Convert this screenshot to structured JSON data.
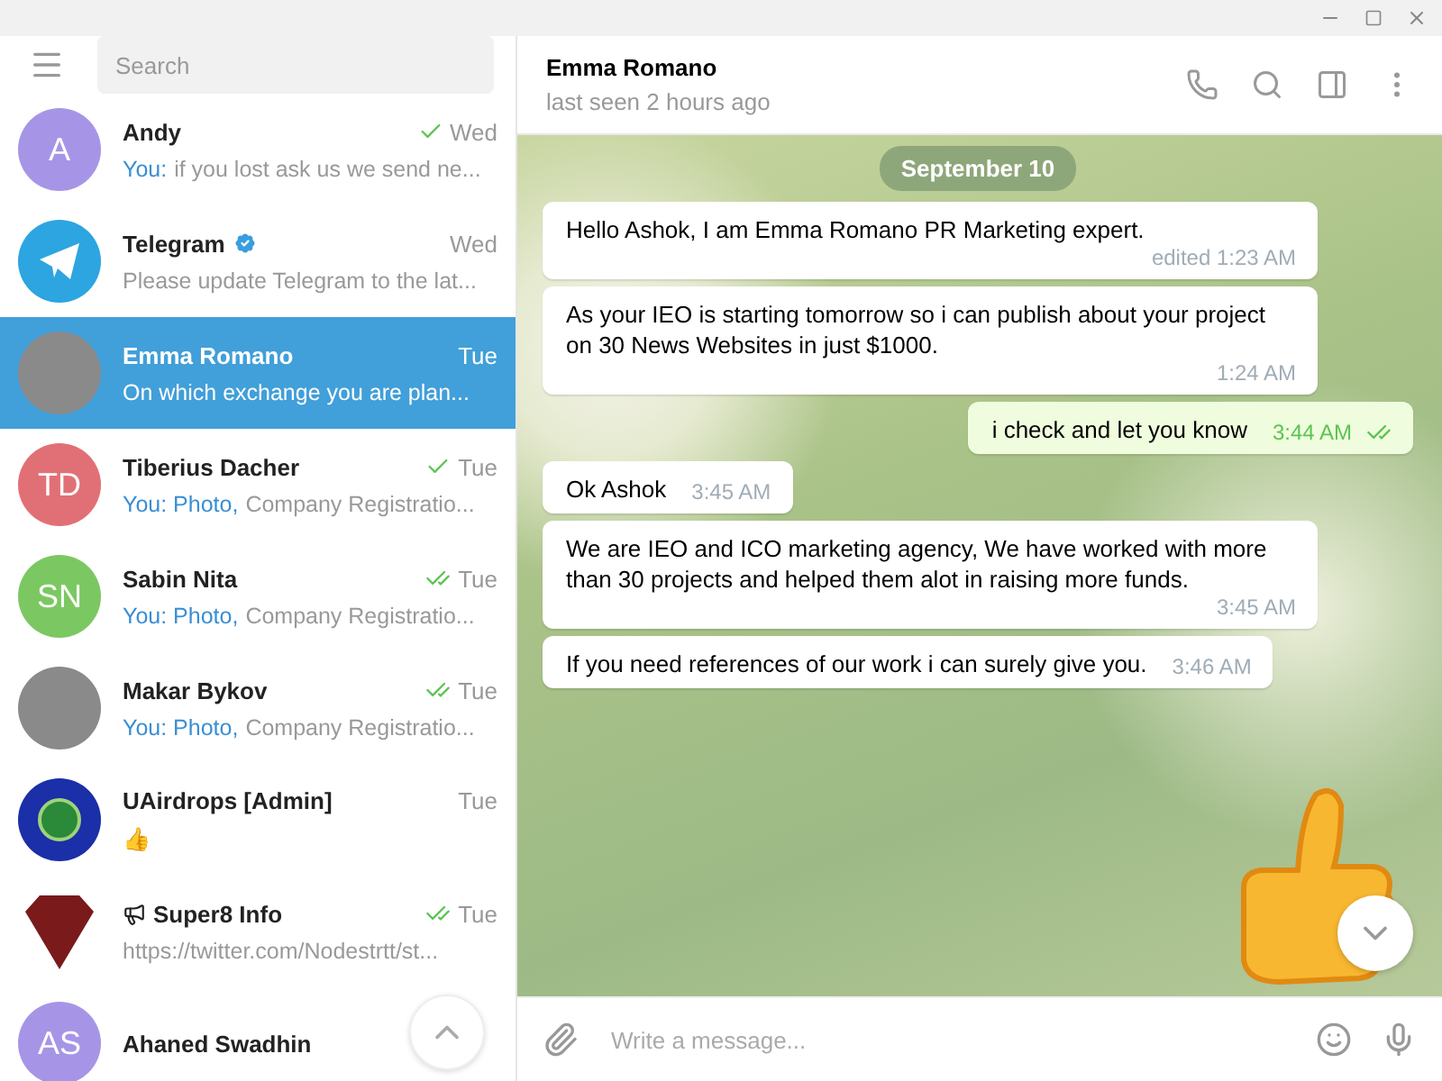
{
  "sidebar": {
    "search": {
      "placeholder": "Search"
    },
    "chats": [
      {
        "name": "Andy",
        "avatar": {
          "kind": "initials",
          "text": "A",
          "color": "#a695e7"
        },
        "time": "Wed",
        "sent": true,
        "read": false,
        "prefix": "You:",
        "preview": "if you lost ask us we send ne...",
        "selected": false
      },
      {
        "name": "Telegram",
        "avatar": {
          "kind": "telegram"
        },
        "verified": true,
        "time": "Wed",
        "sent": false,
        "preview": "Please update Telegram to the lat...",
        "selected": false
      },
      {
        "name": "Emma Romano",
        "avatar": {
          "kind": "photo"
        },
        "time": "Tue",
        "sent": false,
        "preview": "On which exchange you are plan...",
        "selected": true
      },
      {
        "name": "Tiberius Dacher",
        "avatar": {
          "kind": "initials",
          "text": "TD",
          "color": "#e17076"
        },
        "time": "Tue",
        "sent": true,
        "read": false,
        "prefix": "You: Photo,",
        "preview": "Company Registratio...",
        "selected": false
      },
      {
        "name": "Sabin Nita",
        "avatar": {
          "kind": "initials",
          "text": "SN",
          "color": "#7bc862"
        },
        "time": "Tue",
        "sent": true,
        "read": true,
        "prefix": "You: Photo,",
        "preview": "Company Registratio...",
        "selected": false
      },
      {
        "name": "Makar Bykov",
        "avatar": {
          "kind": "photo"
        },
        "time": "Tue",
        "sent": true,
        "read": true,
        "prefix": "You: Photo,",
        "preview": "Company Registratio...",
        "selected": false
      },
      {
        "name": "UAirdrops [Admin]",
        "avatar": {
          "kind": "globe"
        },
        "time": "Tue",
        "sent": false,
        "preview": "👍",
        "selected": false
      },
      {
        "name": "Super8 Info",
        "channel": true,
        "avatar": {
          "kind": "diamond"
        },
        "time": "Tue",
        "sent": true,
        "read": true,
        "preview": "https://twitter.com/Nodestrtt/st...",
        "selected": false
      },
      {
        "name": "Ahaned Swadhin",
        "avatar": {
          "kind": "initials",
          "text": "AS",
          "color": "#a695e7"
        },
        "selected": false
      }
    ]
  },
  "chat": {
    "title": "Emma Romano",
    "subtitle": "last seen 2 hours ago",
    "date": "September 10",
    "messages": [
      {
        "kind": "incoming",
        "text": "Hello Ashok, I am Emma Romano PR Marketing expert.",
        "time": "edited 1:23 AM",
        "block": true
      },
      {
        "kind": "incoming",
        "text": "As your IEO is starting tomorrow so i can publish about your project on 30 News Websites in just $1000.",
        "time": "1:24 AM",
        "block": true
      },
      {
        "kind": "outgoing",
        "text": "i check and let you know",
        "time": "3:44 AM",
        "read": true
      },
      {
        "kind": "incoming",
        "text": "Ok Ashok",
        "time": "3:45 AM"
      },
      {
        "kind": "incoming",
        "text": "We are IEO and ICO marketing agency, We have worked with more than 30 projects and helped them alot in raising more funds.",
        "time": "3:45 AM",
        "block": true
      },
      {
        "kind": "incoming",
        "text": "If you need references of our work i can surely give you.",
        "time": "3:46 AM"
      }
    ],
    "input": {
      "placeholder": "Write a message..."
    }
  }
}
